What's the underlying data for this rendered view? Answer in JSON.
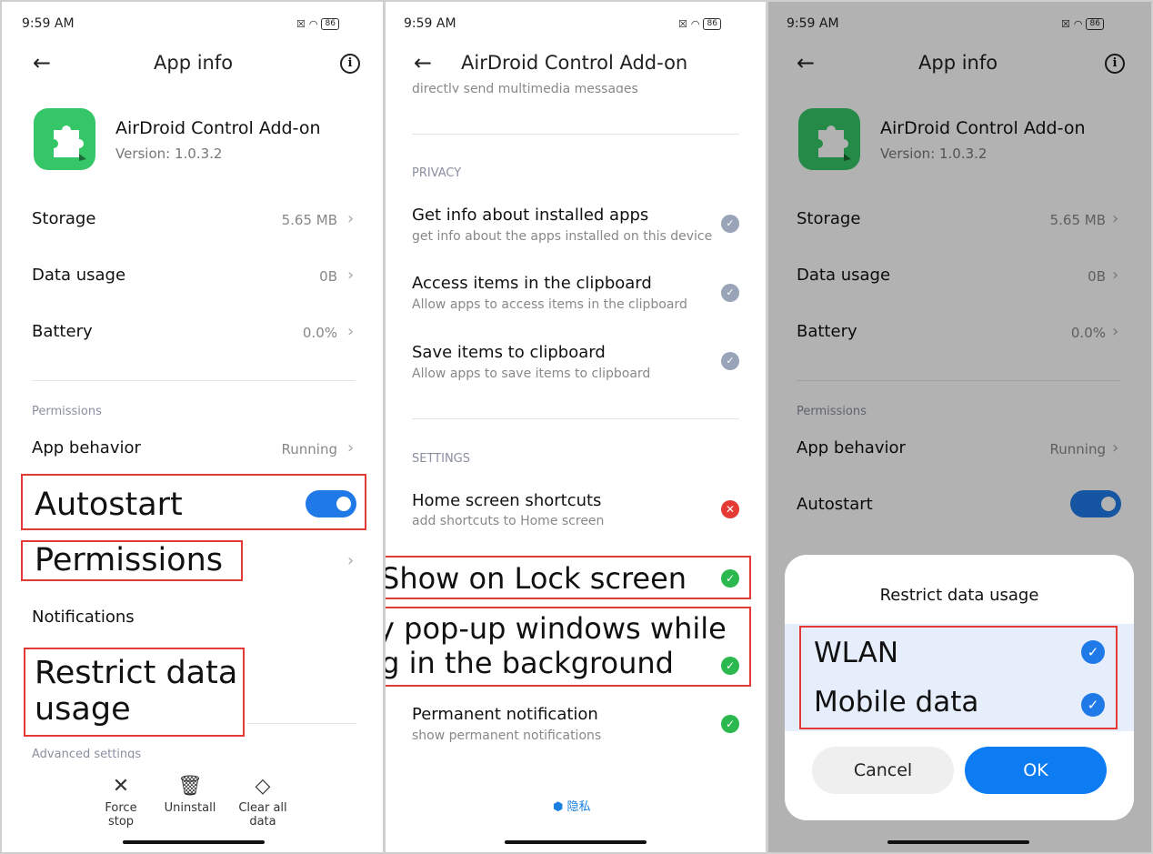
{
  "status": {
    "time": "9:59 AM",
    "battery": "86"
  },
  "p1": {
    "title": "App info",
    "app_name": "AirDroid Control Add-on",
    "version": "Version: 1.0.3.2",
    "rows": [
      {
        "label": "Storage",
        "value": "5.65 MB"
      },
      {
        "label": "Data usage",
        "value": "0B"
      },
      {
        "label": "Battery",
        "value": "0.0%"
      }
    ],
    "section_permissions": "Permissions",
    "app_behavior": {
      "label": "App behavior",
      "value": "Running"
    },
    "autostart": "Autostart",
    "permissions": "Permissions",
    "notifications": "Notifications",
    "restrict_data": "Restrict data usage",
    "advanced": "Advanced settings",
    "actions": [
      {
        "icon": "close-icon",
        "label": "Force stop"
      },
      {
        "icon": "trash-icon",
        "label": "Uninstall"
      },
      {
        "icon": "eraser-icon",
        "label": "Clear all data"
      }
    ]
  },
  "p2": {
    "title": "AirDroid Control Add-on",
    "cut_text": "directly send multimedia messages",
    "section_privacy": "PRIVACY",
    "privacy_items": [
      {
        "title": "Get info about installed apps",
        "sub": "get info about the apps installed on this device"
      },
      {
        "title": "Access items in the clipboard",
        "sub": "Allow apps to access items in the clipboard"
      },
      {
        "title": "Save items to clipboard",
        "sub": "Allow apps to save items to clipboard"
      }
    ],
    "section_settings": "SETTINGS",
    "home_shortcuts": {
      "title": "Home screen shortcuts",
      "sub": "add shortcuts to Home screen"
    },
    "lock_screen": "Show on Lock screen",
    "popup": "Display pop-up windows while running in the background",
    "permanent": {
      "title": "Permanent notification",
      "sub": "show permanent notifications"
    },
    "footer": "隐私"
  },
  "p3": {
    "title": "App info",
    "app_name": "AirDroid Control Add-on",
    "version": "Version: 1.0.3.2",
    "rows": [
      {
        "label": "Storage",
        "value": "5.65 MB"
      },
      {
        "label": "Data usage",
        "value": "0B"
      },
      {
        "label": "Battery",
        "value": "0.0%"
      }
    ],
    "section_permissions": "Permissions",
    "app_behavior": {
      "label": "App behavior",
      "value": "Running"
    },
    "autostart": "Autostart",
    "dialog": {
      "title": "Restrict data usage",
      "options": [
        "WLAN",
        "Mobile data"
      ],
      "cancel": "Cancel",
      "ok": "OK"
    }
  }
}
